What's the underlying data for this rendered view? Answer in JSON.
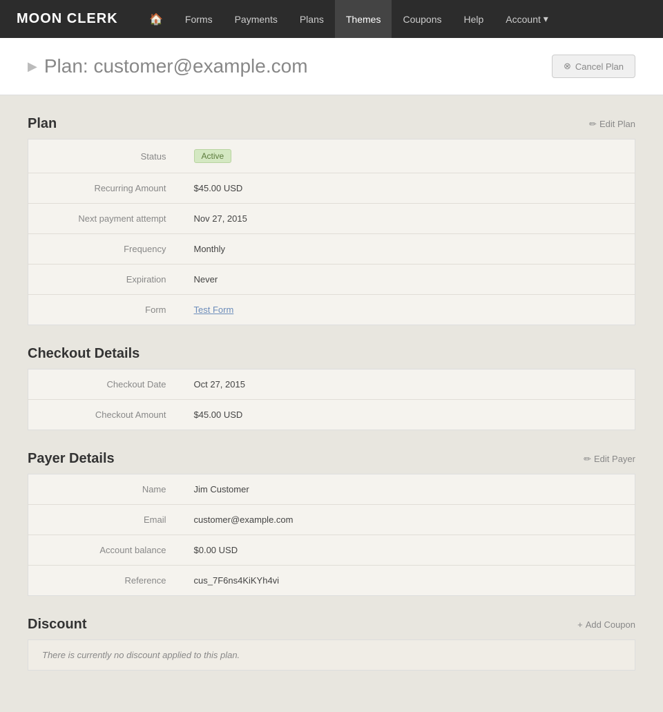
{
  "brand": {
    "logo_text": "MOON CLERK"
  },
  "nav": {
    "home_icon": "🏠",
    "links": [
      {
        "label": "Forms",
        "active": false
      },
      {
        "label": "Payments",
        "active": false
      },
      {
        "label": "Plans",
        "active": false
      },
      {
        "label": "Themes",
        "active": true
      },
      {
        "label": "Coupons",
        "active": false
      },
      {
        "label": "Help",
        "active": false
      }
    ],
    "account_label": "Account",
    "account_arrow": "▾"
  },
  "page": {
    "title": "Plan: customer@example.com",
    "cancel_button": "Cancel Plan"
  },
  "plan_section": {
    "title": "Plan",
    "edit_label": "Edit Plan",
    "rows": [
      {
        "label": "Status",
        "value": "Active",
        "type": "badge"
      },
      {
        "label": "Recurring Amount",
        "value": "$45.00 USD",
        "type": "text"
      },
      {
        "label": "Next payment attempt",
        "value": "Nov 27, 2015",
        "type": "text"
      },
      {
        "label": "Frequency",
        "value": "Monthly",
        "type": "text"
      },
      {
        "label": "Expiration",
        "value": "Never",
        "type": "text"
      },
      {
        "label": "Form",
        "value": "Test Form",
        "type": "link"
      }
    ]
  },
  "checkout_section": {
    "title": "Checkout Details",
    "rows": [
      {
        "label": "Checkout Date",
        "value": "Oct 27, 2015",
        "type": "text"
      },
      {
        "label": "Checkout Amount",
        "value": "$45.00 USD",
        "type": "text"
      }
    ]
  },
  "payer_section": {
    "title": "Payer Details",
    "edit_label": "Edit Payer",
    "rows": [
      {
        "label": "Name",
        "value": "Jim Customer",
        "type": "text"
      },
      {
        "label": "Email",
        "value": "customer@example.com",
        "type": "text"
      },
      {
        "label": "Account balance",
        "value": "$0.00 USD",
        "type": "text"
      },
      {
        "label": "Reference",
        "value": "cus_7F6ns4KiKYh4vi",
        "type": "text"
      }
    ]
  },
  "discount_section": {
    "title": "Discount",
    "add_label": "Add Coupon",
    "empty_text": "There is currently no discount applied to this plan."
  }
}
